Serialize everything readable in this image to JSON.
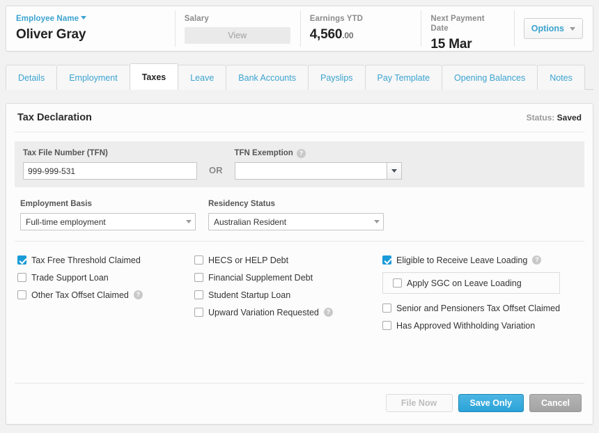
{
  "employee_header": {
    "name_label": "Employee Name",
    "name_value": "Oliver Gray",
    "salary_label": "Salary",
    "salary_button": "View",
    "earnings_label": "Earnings YTD",
    "earnings_value": "4,560",
    "earnings_cents": ".00",
    "next_payment_label": "Next Payment Date",
    "next_payment_value": "15 Mar",
    "options_button": "Options"
  },
  "tabs": [
    {
      "label": "Details",
      "active": false
    },
    {
      "label": "Employment",
      "active": false
    },
    {
      "label": "Taxes",
      "active": true
    },
    {
      "label": "Leave",
      "active": false
    },
    {
      "label": "Bank Accounts",
      "active": false
    },
    {
      "label": "Payslips",
      "active": false
    },
    {
      "label": "Pay Template",
      "active": false
    },
    {
      "label": "Opening Balances",
      "active": false
    },
    {
      "label": "Notes",
      "active": false
    }
  ],
  "card": {
    "title": "Tax Declaration",
    "status_label": "Status:",
    "status_value": "Saved"
  },
  "tfn": {
    "tfn_label": "Tax File Number (TFN)",
    "tfn_value": "999-999-531",
    "or_text": "OR",
    "exemption_label": "TFN Exemption",
    "exemption_value": "",
    "exemption_placeholder": "",
    "help_glyph": "?"
  },
  "selects": {
    "employment_basis_label": "Employment Basis",
    "employment_basis_value": "Full-time employment",
    "residency_status_label": "Residency Status",
    "residency_status_value": "Australian Resident"
  },
  "checkboxes": {
    "column_1": [
      {
        "label": "Tax Free Threshold Claimed",
        "checked": true,
        "help": false
      },
      {
        "label": "Trade Support Loan",
        "checked": false,
        "help": false
      },
      {
        "label": "Other Tax Offset Claimed",
        "checked": false,
        "help": true
      }
    ],
    "column_2": [
      {
        "label": "HECS or HELP Debt",
        "checked": false,
        "help": false
      },
      {
        "label": "Financial Supplement Debt",
        "checked": false,
        "help": false
      },
      {
        "label": "Student Startup Loan",
        "checked": false,
        "help": false
      },
      {
        "label": "Upward Variation Requested",
        "checked": false,
        "help": true
      }
    ],
    "column_3": [
      {
        "label": "Eligible to Receive Leave Loading",
        "checked": true,
        "help": true
      },
      {
        "label": "Senior and Pensioners Tax Offset Claimed",
        "checked": false,
        "help": false
      },
      {
        "label": "Has Approved Withholding Variation",
        "checked": false,
        "help": false
      }
    ],
    "sgc": {
      "label": "Apply SGC on Leave Loading",
      "checked": false
    }
  },
  "footer": {
    "file_now": "File Now",
    "save_only": "Save Only",
    "cancel": "Cancel"
  },
  "colors": {
    "accent_blue": "#3ba3d0",
    "primary_button": "#2ba3d8",
    "checked_box": "#1a9bd7",
    "panel_grey": "#ededed",
    "page_background": "#f2f2f2"
  }
}
